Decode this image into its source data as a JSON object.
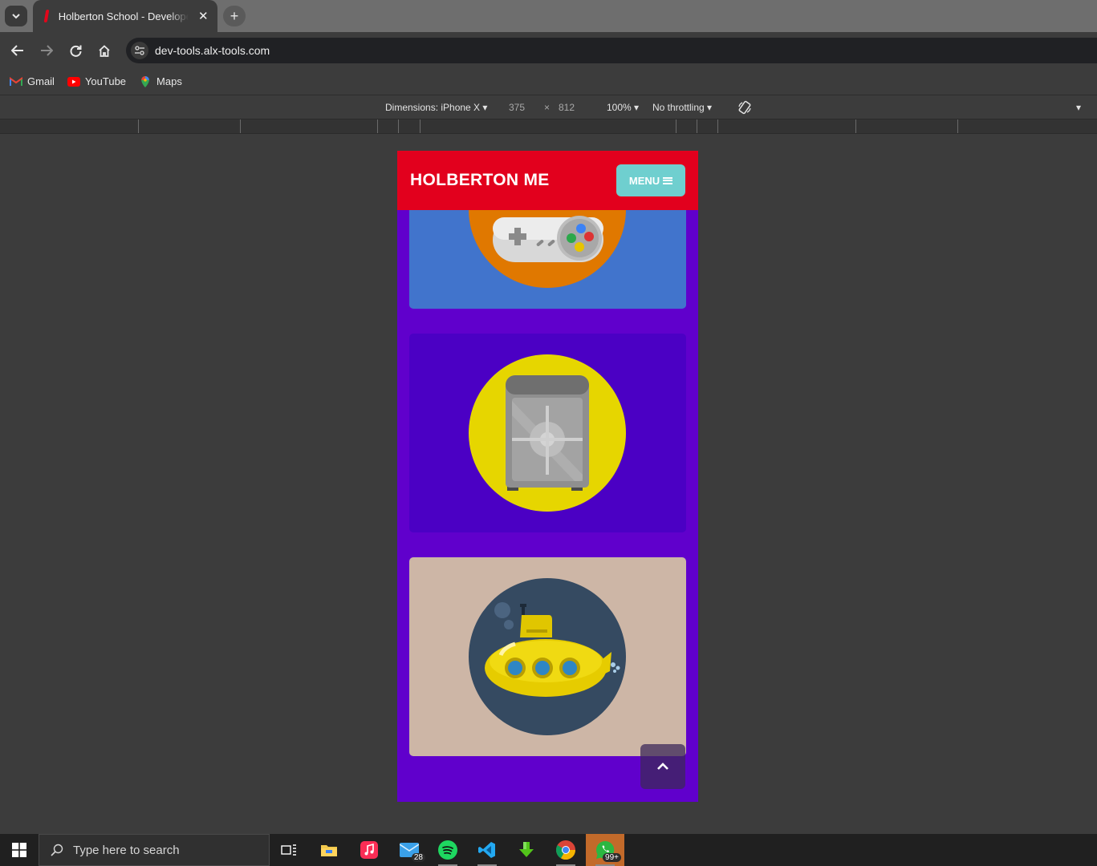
{
  "browser": {
    "tab_title": "Holberton School - Developer t",
    "url": "dev-tools.alx-tools.com",
    "bookmarks": [
      {
        "label": "Gmail",
        "icon": "gmail-icon"
      },
      {
        "label": "YouTube",
        "icon": "youtube-icon"
      },
      {
        "label": "Maps",
        "icon": "maps-icon"
      }
    ]
  },
  "device_toolbar": {
    "dimensions_label": "Dimensions: iPhone X",
    "width": "375",
    "times": "×",
    "height": "812",
    "zoom": "100%",
    "throttling": "No throttling"
  },
  "site": {
    "brand": "HOLBERTON ME",
    "menu_label": "MENU",
    "header_color": "#e2001d",
    "menu_color": "#6fcfcf",
    "page_bg": "#6000cc",
    "cards": [
      {
        "name": "game-controller",
        "bg": "#4174cc",
        "circle": "#e07800"
      },
      {
        "name": "safe",
        "bg": "#4b00c4",
        "circle": "#e6d600"
      },
      {
        "name": "submarine",
        "bg": "#cdb6a6",
        "circle": "#354a61"
      }
    ],
    "back_to_top_icon": "chevron-up-icon"
  },
  "taskbar": {
    "search_placeholder": "Type here to search",
    "mail_badge": "28",
    "whatsapp_badge": "99+"
  }
}
